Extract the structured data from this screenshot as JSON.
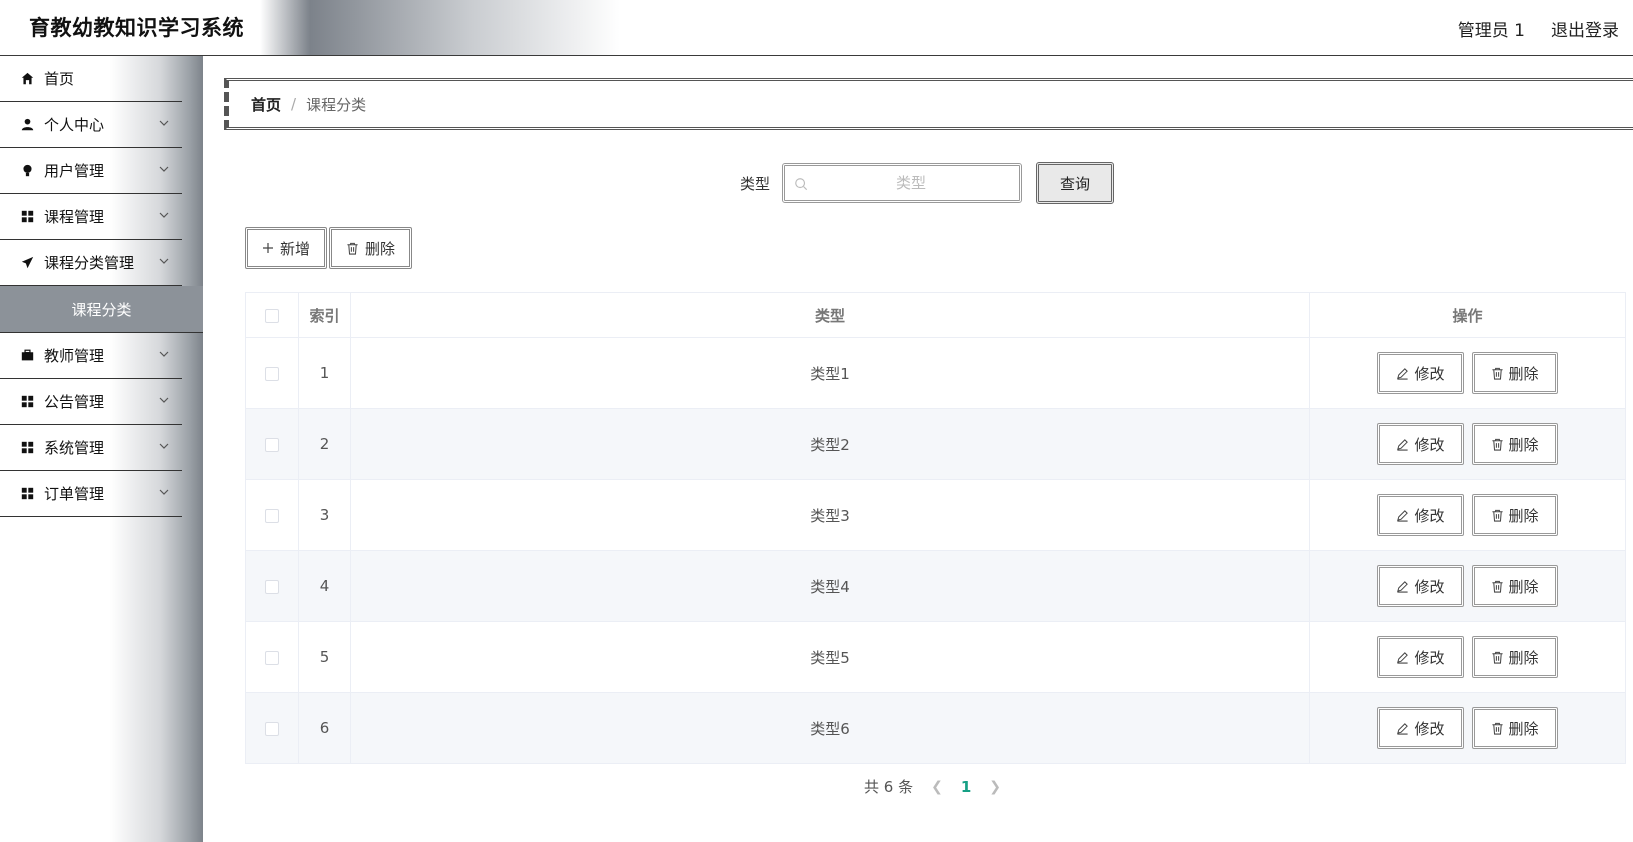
{
  "header": {
    "title": "育教幼教知识学习系统",
    "user": "管理员 1",
    "logout": "退出登录"
  },
  "sidebar": {
    "items": [
      {
        "label": "首页",
        "icon": "home-icon"
      },
      {
        "label": "个人中心",
        "icon": "user-icon"
      },
      {
        "label": "用户管理",
        "icon": "bulb-icon"
      },
      {
        "label": "课程管理",
        "icon": "grid-icon"
      },
      {
        "label": "课程分类管理",
        "icon": "send-icon"
      },
      {
        "label": "教师管理",
        "icon": "briefcase-icon"
      },
      {
        "label": "公告管理",
        "icon": "grid-icon"
      },
      {
        "label": "系统管理",
        "icon": "grid-icon"
      },
      {
        "label": "订单管理",
        "icon": "grid-icon"
      }
    ],
    "active_sub": "课程分类"
  },
  "breadcrumb": {
    "home": "首页",
    "separator": "/",
    "current": "课程分类"
  },
  "search": {
    "label": "类型",
    "placeholder": "类型",
    "value": "",
    "button": "查询"
  },
  "toolbar": {
    "add": "新增",
    "delete": "删除"
  },
  "table": {
    "headers": [
      "",
      "索引",
      "类型",
      "操作"
    ],
    "rows": [
      {
        "index": "1",
        "type": "类型1"
      },
      {
        "index": "2",
        "type": "类型2"
      },
      {
        "index": "3",
        "type": "类型3"
      },
      {
        "index": "4",
        "type": "类型4"
      },
      {
        "index": "5",
        "type": "类型5"
      },
      {
        "index": "6",
        "type": "类型6"
      }
    ],
    "edit_label": "修改",
    "delete_label": "删除"
  },
  "pagination": {
    "total": "共 6 条",
    "current": "1"
  },
  "colors": {
    "accent": "#16a085",
    "submenu_bg": "#8c9299"
  }
}
